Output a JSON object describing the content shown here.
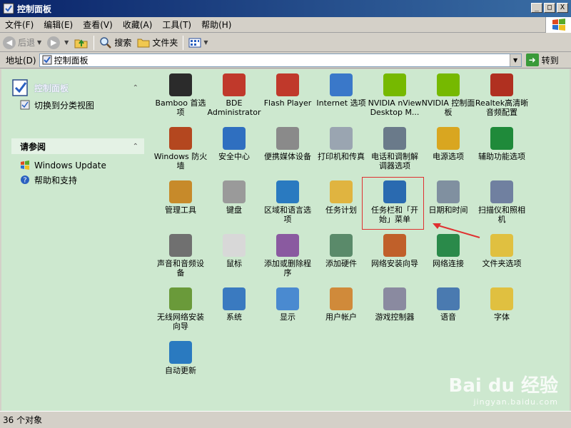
{
  "window": {
    "title": "控制面板",
    "controls": {
      "minimize": "_",
      "maximize": "□",
      "close": "X"
    }
  },
  "menubar": {
    "items": [
      "文件(F)",
      "编辑(E)",
      "查看(V)",
      "收藏(A)",
      "工具(T)",
      "帮助(H)"
    ]
  },
  "toolbar": {
    "back": "后退",
    "search": "搜索",
    "folders": "文件夹"
  },
  "addressbar": {
    "label": "地址(D)",
    "value": "控制面板",
    "go": "转到"
  },
  "left_pane": {
    "panel1": {
      "title": "控制面板",
      "link": "切换到分类视图"
    },
    "panel2": {
      "title": "请参阅",
      "links": [
        "Windows Update",
        "帮助和支持"
      ]
    }
  },
  "icons": [
    {
      "label": "Bamboo 首选项",
      "color": "#2b2b2b"
    },
    {
      "label": "BDE Administrator",
      "color": "#c0392b"
    },
    {
      "label": "Flash Player",
      "color": "#c0392b"
    },
    {
      "label": "Internet 选项",
      "color": "#3a78c9"
    },
    {
      "label": "NVIDIA nView Desktop M...",
      "color": "#76b900"
    },
    {
      "label": "NVIDIA 控制面板",
      "color": "#76b900"
    },
    {
      "label": "Realtek高清晰音频配置",
      "color": "#b03020"
    },
    {
      "label": "Windows 防火墙",
      "color": "#b4471f"
    },
    {
      "label": "安全中心",
      "color": "#2f6fc0"
    },
    {
      "label": "便携媒体设备",
      "color": "#8a8a8a"
    },
    {
      "label": "打印机和传真",
      "color": "#9aa5b1"
    },
    {
      "label": "电话和调制解调器选项",
      "color": "#6a7a8a"
    },
    {
      "label": "电源选项",
      "color": "#d9a620"
    },
    {
      "label": "辅助功能选项",
      "color": "#1f8a3a"
    },
    {
      "label": "管理工具",
      "color": "#c78a2a"
    },
    {
      "label": "键盘",
      "color": "#9a9a9a"
    },
    {
      "label": "区域和语言选项",
      "color": "#2a7ac0"
    },
    {
      "label": "任务计划",
      "color": "#e0b440"
    },
    {
      "label": "任务栏和「开始」菜单",
      "color": "#2a6ab0"
    },
    {
      "label": "日期和时间",
      "color": "#8090a0"
    },
    {
      "label": "扫描仪和照相机",
      "color": "#7080a0"
    },
    {
      "label": "声音和音频设备",
      "color": "#707070"
    },
    {
      "label": "鼠标",
      "color": "#d8d8d8"
    },
    {
      "label": "添加或删除程序",
      "color": "#8a5aa0"
    },
    {
      "label": "添加硬件",
      "color": "#5a8a6a"
    },
    {
      "label": "网络安装向导",
      "color": "#c0602a"
    },
    {
      "label": "网络连接",
      "color": "#2a8a4a"
    },
    {
      "label": "文件夹选项",
      "color": "#e0c040"
    },
    {
      "label": "无线网络安装向导",
      "color": "#6a9a3a"
    },
    {
      "label": "系统",
      "color": "#3a7ac0"
    },
    {
      "label": "显示",
      "color": "#4a8ad0"
    },
    {
      "label": "用户帐户",
      "color": "#d08a3a"
    },
    {
      "label": "游戏控制器",
      "color": "#8a8aa0"
    },
    {
      "label": "语音",
      "color": "#4a7ab0"
    },
    {
      "label": "字体",
      "color": "#e0c040"
    },
    {
      "label": "自动更新",
      "color": "#2a7ac0"
    }
  ],
  "statusbar": {
    "text": "36 个对象"
  },
  "watermark": {
    "main": "Bai du 经验",
    "sub": "jingyan.baidu.com"
  }
}
